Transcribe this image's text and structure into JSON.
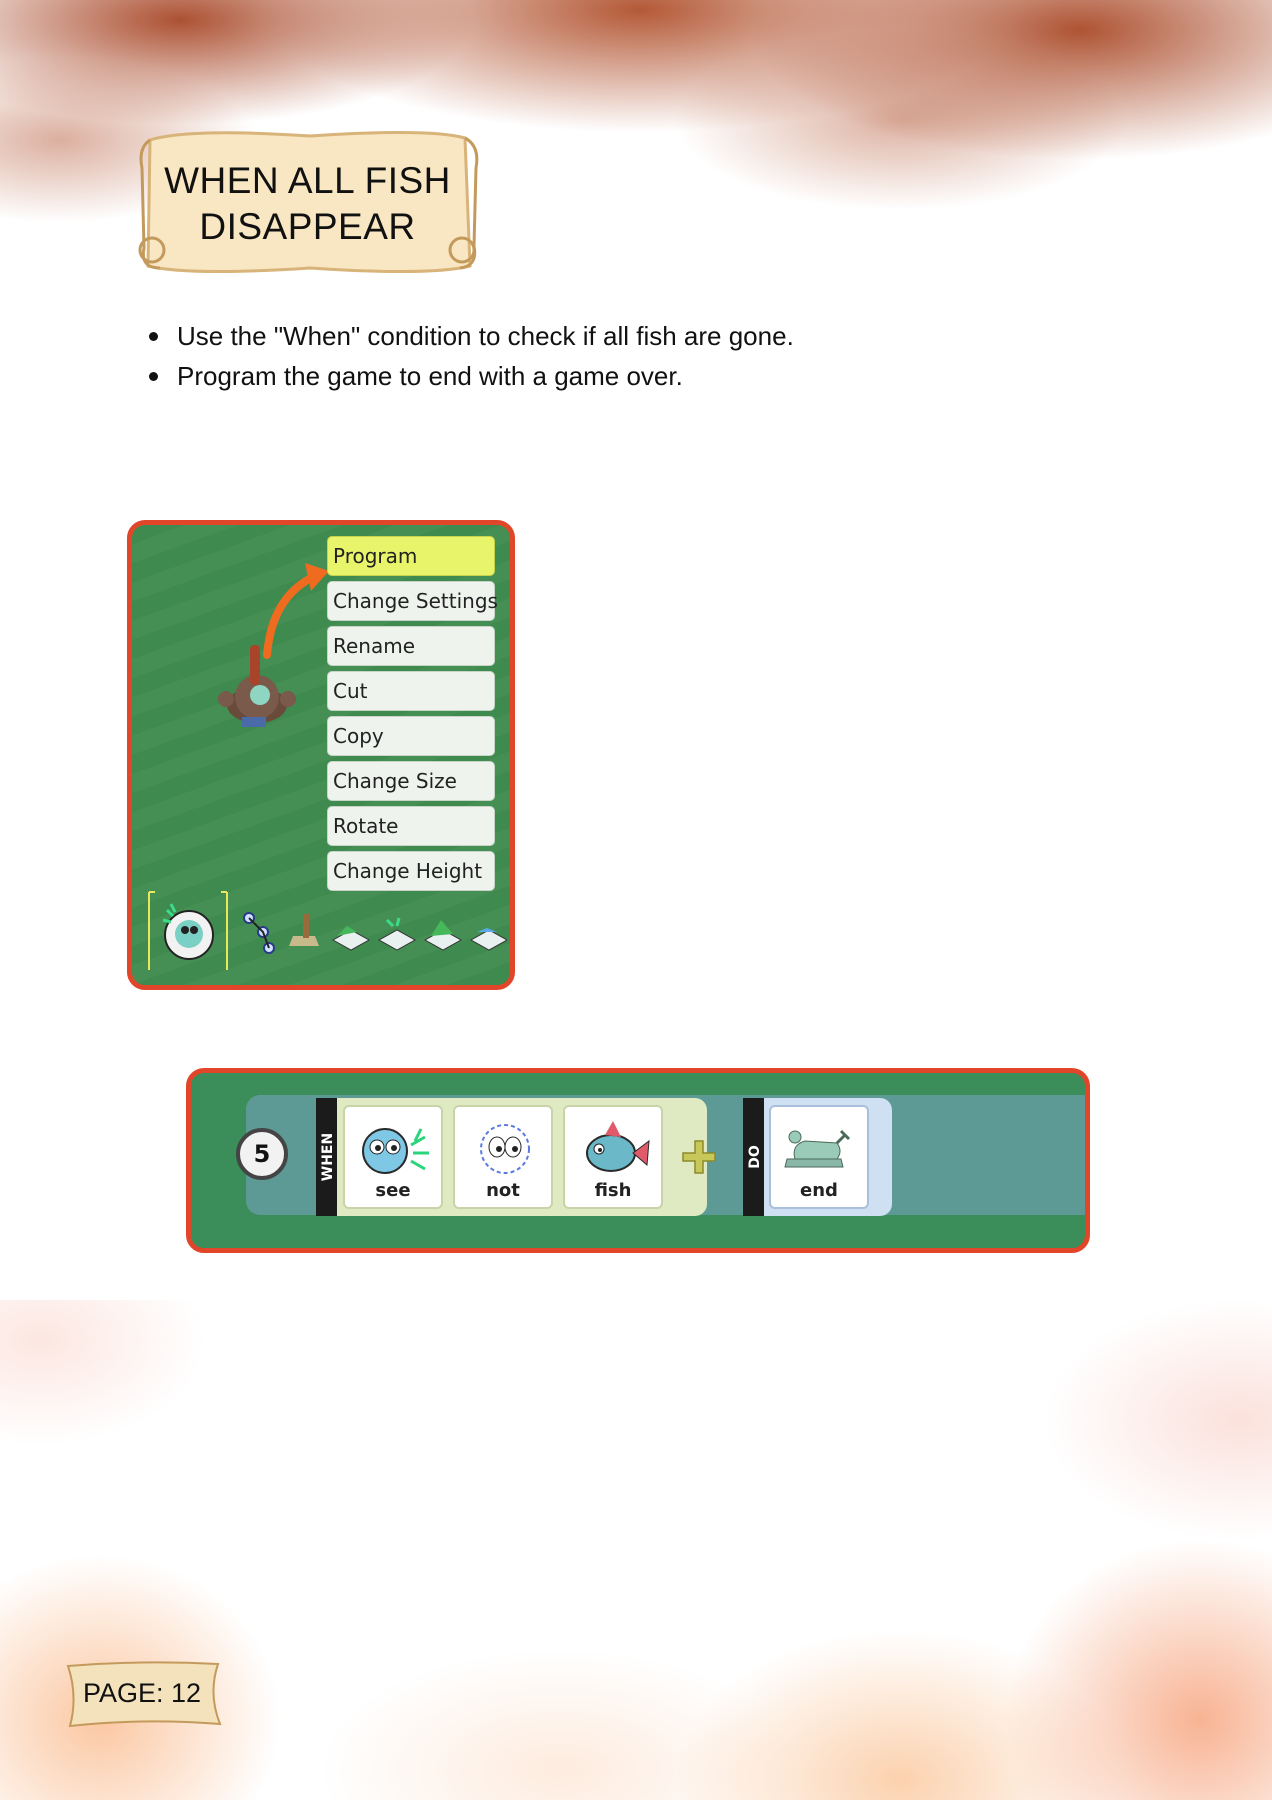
{
  "title": "WHEN ALL FISH\nDISAPPEAR",
  "bullets": [
    "Use the \"When\" condition to check if all fish are gone.",
    "Program the game to end with a game over."
  ],
  "context_menu": {
    "items": [
      "Program",
      "Change Settings",
      "Rename",
      "Cut",
      "Copy",
      "Change Size",
      "Rotate",
      "Change Height"
    ],
    "selected": "Program"
  },
  "rule": {
    "number": "5",
    "when_label": "WHEN",
    "do_label": "DO",
    "when_tiles": [
      "see",
      "not",
      "fish"
    ],
    "do_tiles": [
      "end"
    ]
  },
  "page_label": "PAGE: 12",
  "colors": {
    "frame": "#e2462a",
    "menu_highlight": "#e8f56a",
    "grass": "#3f8a4f",
    "when_group": "#dfe9c2",
    "do_group": "#cfe0f2"
  },
  "icons": {
    "toolbar": [
      "kodu-character-icon",
      "path-tool-icon",
      "paint-brush-icon",
      "terrain-add-icon",
      "terrain-smooth-icon",
      "terrain-hill-icon",
      "water-icon"
    ],
    "tiles": [
      "see-eye-icon",
      "not-eye-icon",
      "fish-icon",
      "end-chess-king-icon",
      "plus-icon"
    ]
  }
}
